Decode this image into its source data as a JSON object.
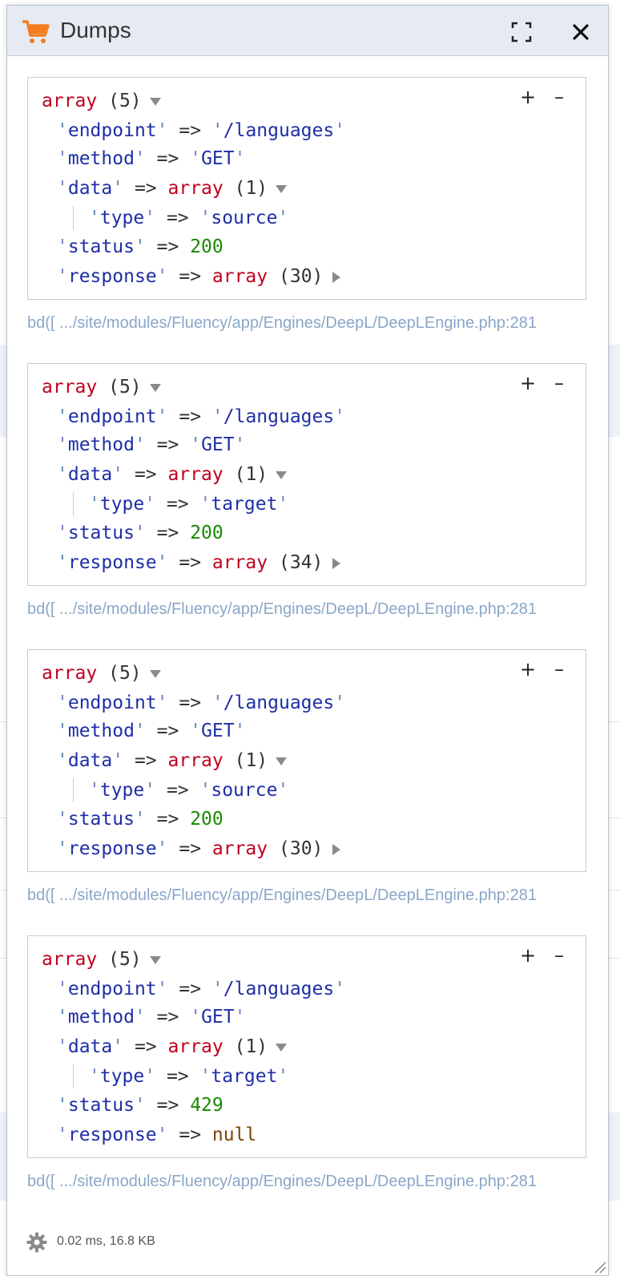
{
  "panel": {
    "title": "Dumps",
    "icon": "cart-icon",
    "accent_color": "#f37e21"
  },
  "controls": {
    "expand_all": "+",
    "collapse_all": "–"
  },
  "dumps": [
    {
      "header_type": "array",
      "header_count": "(5)",
      "rows": [
        {
          "key": "endpoint",
          "value": "/languages"
        },
        {
          "key": "method",
          "value": "GET"
        },
        {
          "key": "data",
          "value_type": "array",
          "value_count": "(1)",
          "children": [
            {
              "key": "type",
              "value": "source"
            }
          ]
        },
        {
          "key": "status",
          "value": "200"
        },
        {
          "key": "response",
          "value_type": "array",
          "value_count": "(30)"
        }
      ],
      "source": "bd([ .../site/modules/Fluency/app/Engines/DeepL/DeepLEngine.php:281"
    },
    {
      "header_type": "array",
      "header_count": "(5)",
      "rows": [
        {
          "key": "endpoint",
          "value": "/languages"
        },
        {
          "key": "method",
          "value": "GET"
        },
        {
          "key": "data",
          "value_type": "array",
          "value_count": "(1)",
          "children": [
            {
              "key": "type",
              "value": "target"
            }
          ]
        },
        {
          "key": "status",
          "value": "200"
        },
        {
          "key": "response",
          "value_type": "array",
          "value_count": "(34)"
        }
      ],
      "source": "bd([ .../site/modules/Fluency/app/Engines/DeepL/DeepLEngine.php:281"
    },
    {
      "header_type": "array",
      "header_count": "(5)",
      "rows": [
        {
          "key": "endpoint",
          "value": "/languages"
        },
        {
          "key": "method",
          "value": "GET"
        },
        {
          "key": "data",
          "value_type": "array",
          "value_count": "(1)",
          "children": [
            {
              "key": "type",
              "value": "source"
            }
          ]
        },
        {
          "key": "status",
          "value": "200"
        },
        {
          "key": "response",
          "value_type": "array",
          "value_count": "(30)"
        }
      ],
      "source": "bd([ .../site/modules/Fluency/app/Engines/DeepL/DeepLEngine.php:281"
    },
    {
      "header_type": "array",
      "header_count": "(5)",
      "rows": [
        {
          "key": "endpoint",
          "value": "/languages"
        },
        {
          "key": "method",
          "value": "GET"
        },
        {
          "key": "data",
          "value_type": "array",
          "value_count": "(1)",
          "children": [
            {
              "key": "type",
              "value": "target"
            }
          ]
        },
        {
          "key": "status",
          "value": "429"
        },
        {
          "key": "response",
          "value": "null"
        }
      ],
      "source": "bd([ .../site/modules/Fluency/app/Engines/DeepL/DeepLEngine.php:281"
    }
  ],
  "footer": {
    "stats": "0.02 ms, 16.8 KB",
    "icon": "gear-icon"
  },
  "syntax_colors": {
    "keyword": "#c0001e",
    "key": "#1e2ea6",
    "number": "#1a8a00",
    "null": "#7a4400"
  }
}
